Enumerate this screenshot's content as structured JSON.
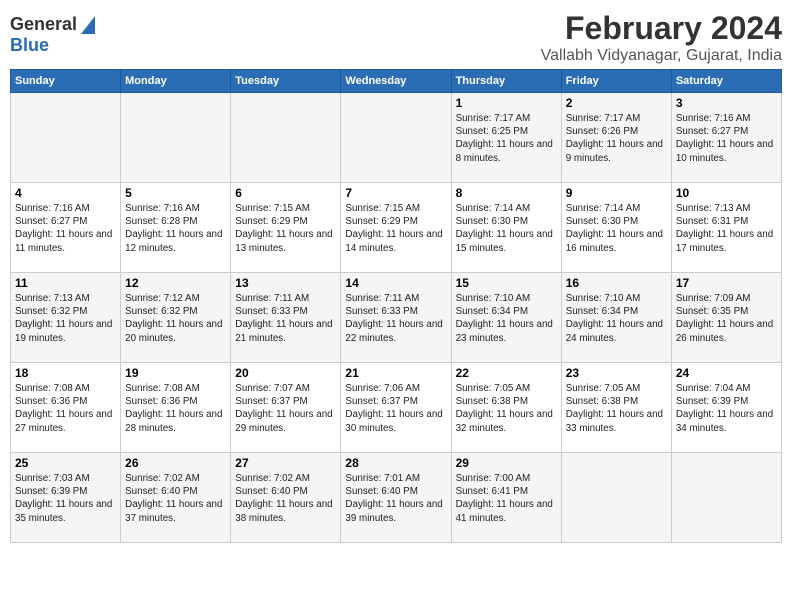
{
  "header": {
    "logo_general": "General",
    "logo_blue": "Blue",
    "title": "February 2024",
    "location": "Vallabh Vidyanagar, Gujarat, India"
  },
  "days_of_week": [
    "Sunday",
    "Monday",
    "Tuesday",
    "Wednesday",
    "Thursday",
    "Friday",
    "Saturday"
  ],
  "weeks": [
    [
      {
        "day": "",
        "sunrise": "",
        "sunset": "",
        "daylight": ""
      },
      {
        "day": "",
        "sunrise": "",
        "sunset": "",
        "daylight": ""
      },
      {
        "day": "",
        "sunrise": "",
        "sunset": "",
        "daylight": ""
      },
      {
        "day": "",
        "sunrise": "",
        "sunset": "",
        "daylight": ""
      },
      {
        "day": "1",
        "sunrise": "7:17 AM",
        "sunset": "6:25 PM",
        "daylight": "11 hours and 8 minutes."
      },
      {
        "day": "2",
        "sunrise": "7:17 AM",
        "sunset": "6:26 PM",
        "daylight": "11 hours and 9 minutes."
      },
      {
        "day": "3",
        "sunrise": "7:16 AM",
        "sunset": "6:27 PM",
        "daylight": "11 hours and 10 minutes."
      }
    ],
    [
      {
        "day": "4",
        "sunrise": "7:16 AM",
        "sunset": "6:27 PM",
        "daylight": "11 hours and 11 minutes."
      },
      {
        "day": "5",
        "sunrise": "7:16 AM",
        "sunset": "6:28 PM",
        "daylight": "11 hours and 12 minutes."
      },
      {
        "day": "6",
        "sunrise": "7:15 AM",
        "sunset": "6:29 PM",
        "daylight": "11 hours and 13 minutes."
      },
      {
        "day": "7",
        "sunrise": "7:15 AM",
        "sunset": "6:29 PM",
        "daylight": "11 hours and 14 minutes."
      },
      {
        "day": "8",
        "sunrise": "7:14 AM",
        "sunset": "6:30 PM",
        "daylight": "11 hours and 15 minutes."
      },
      {
        "day": "9",
        "sunrise": "7:14 AM",
        "sunset": "6:30 PM",
        "daylight": "11 hours and 16 minutes."
      },
      {
        "day": "10",
        "sunrise": "7:13 AM",
        "sunset": "6:31 PM",
        "daylight": "11 hours and 17 minutes."
      }
    ],
    [
      {
        "day": "11",
        "sunrise": "7:13 AM",
        "sunset": "6:32 PM",
        "daylight": "11 hours and 19 minutes."
      },
      {
        "day": "12",
        "sunrise": "7:12 AM",
        "sunset": "6:32 PM",
        "daylight": "11 hours and 20 minutes."
      },
      {
        "day": "13",
        "sunrise": "7:11 AM",
        "sunset": "6:33 PM",
        "daylight": "11 hours and 21 minutes."
      },
      {
        "day": "14",
        "sunrise": "7:11 AM",
        "sunset": "6:33 PM",
        "daylight": "11 hours and 22 minutes."
      },
      {
        "day": "15",
        "sunrise": "7:10 AM",
        "sunset": "6:34 PM",
        "daylight": "11 hours and 23 minutes."
      },
      {
        "day": "16",
        "sunrise": "7:10 AM",
        "sunset": "6:34 PM",
        "daylight": "11 hours and 24 minutes."
      },
      {
        "day": "17",
        "sunrise": "7:09 AM",
        "sunset": "6:35 PM",
        "daylight": "11 hours and 26 minutes."
      }
    ],
    [
      {
        "day": "18",
        "sunrise": "7:08 AM",
        "sunset": "6:36 PM",
        "daylight": "11 hours and 27 minutes."
      },
      {
        "day": "19",
        "sunrise": "7:08 AM",
        "sunset": "6:36 PM",
        "daylight": "11 hours and 28 minutes."
      },
      {
        "day": "20",
        "sunrise": "7:07 AM",
        "sunset": "6:37 PM",
        "daylight": "11 hours and 29 minutes."
      },
      {
        "day": "21",
        "sunrise": "7:06 AM",
        "sunset": "6:37 PM",
        "daylight": "11 hours and 30 minutes."
      },
      {
        "day": "22",
        "sunrise": "7:05 AM",
        "sunset": "6:38 PM",
        "daylight": "11 hours and 32 minutes."
      },
      {
        "day": "23",
        "sunrise": "7:05 AM",
        "sunset": "6:38 PM",
        "daylight": "11 hours and 33 minutes."
      },
      {
        "day": "24",
        "sunrise": "7:04 AM",
        "sunset": "6:39 PM",
        "daylight": "11 hours and 34 minutes."
      }
    ],
    [
      {
        "day": "25",
        "sunrise": "7:03 AM",
        "sunset": "6:39 PM",
        "daylight": "11 hours and 35 minutes."
      },
      {
        "day": "26",
        "sunrise": "7:02 AM",
        "sunset": "6:40 PM",
        "daylight": "11 hours and 37 minutes."
      },
      {
        "day": "27",
        "sunrise": "7:02 AM",
        "sunset": "6:40 PM",
        "daylight": "11 hours and 38 minutes."
      },
      {
        "day": "28",
        "sunrise": "7:01 AM",
        "sunset": "6:40 PM",
        "daylight": "11 hours and 39 minutes."
      },
      {
        "day": "29",
        "sunrise": "7:00 AM",
        "sunset": "6:41 PM",
        "daylight": "11 hours and 41 minutes."
      },
      {
        "day": "",
        "sunrise": "",
        "sunset": "",
        "daylight": ""
      },
      {
        "day": "",
        "sunrise": "",
        "sunset": "",
        "daylight": ""
      }
    ]
  ]
}
